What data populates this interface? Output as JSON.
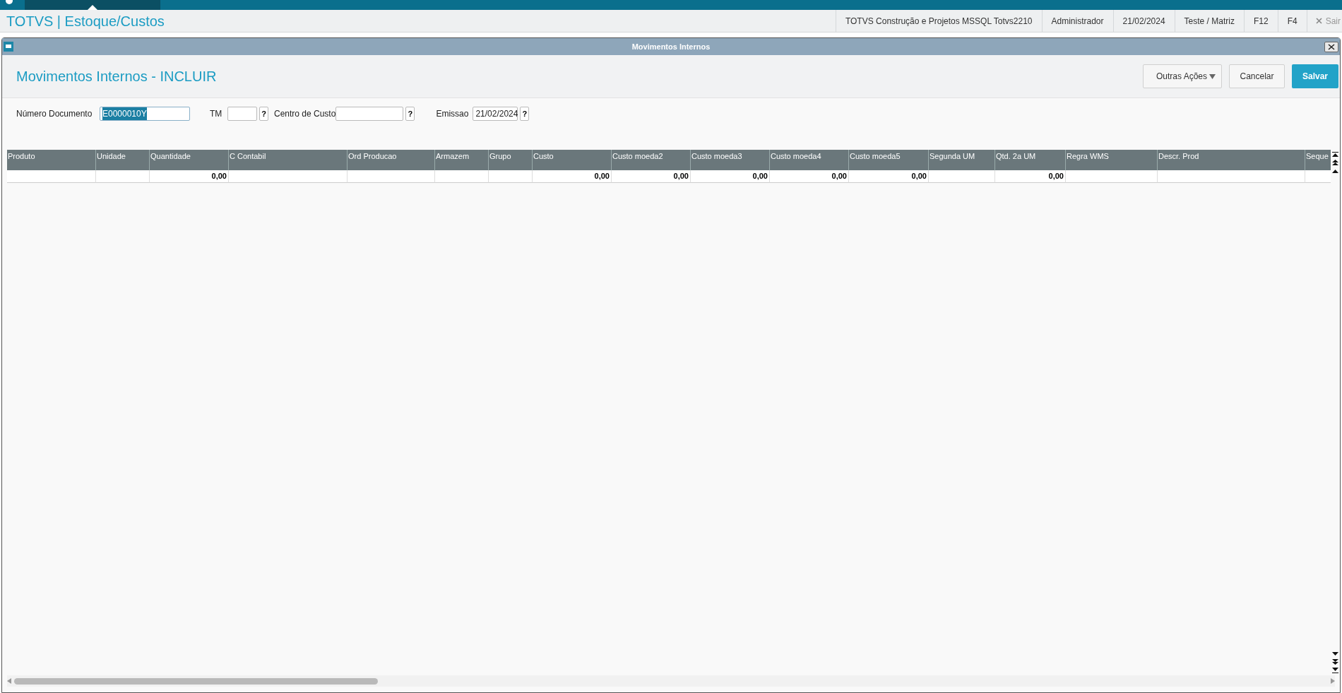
{
  "app_header": {
    "title": "TOTVS | Estoque/Custos",
    "info": [
      "TOTVS Construção e Projetos MSSQL Totvs2210",
      "Administrador",
      "21/02/2024",
      "Teste / Matriz",
      "F12",
      "F4"
    ],
    "exit_label": "Sair"
  },
  "dialog": {
    "title": "Movimentos Internos",
    "heading": "Movimentos Internos - INCLUIR",
    "actions": [
      {
        "label": "Outras Ações",
        "kind": "menu"
      },
      {
        "label": "Cancelar",
        "kind": "plain"
      },
      {
        "label": "Salvar",
        "kind": "primary"
      }
    ]
  },
  "fields": [
    {
      "label": "Número Documento",
      "value": "E0000010Y",
      "selected": true,
      "lookup": false
    },
    {
      "label": "TM",
      "lookup": true,
      "selected": false
    },
    {
      "label": "Centro de Custo",
      "lookup": true,
      "selected": false
    },
    {
      "label": "Emissao",
      "value": "21/02/2024",
      "lookup": true,
      "selected": false
    }
  ],
  "lookup_label": "?",
  "grid": {
    "columns": [
      "Produto",
      "Unidade",
      "Quantidade",
      "C Contabil",
      "Ord Producao",
      "Armazem",
      "Grupo",
      "Custo",
      "Custo moeda2",
      "Custo moeda3",
      "Custo moeda4",
      "Custo moeda5",
      "Segunda UM",
      "Qtd. 2a UM",
      "Regra WMS",
      "Descr. Prod",
      "Seque"
    ],
    "rows": [
      {
        "cells": [
          null,
          null,
          "0,00",
          null,
          null,
          null,
          null,
          "0,00",
          "0,00",
          "0,00",
          "0,00",
          "0,00",
          null,
          "0,00",
          null,
          null,
          null
        ]
      }
    ]
  }
}
